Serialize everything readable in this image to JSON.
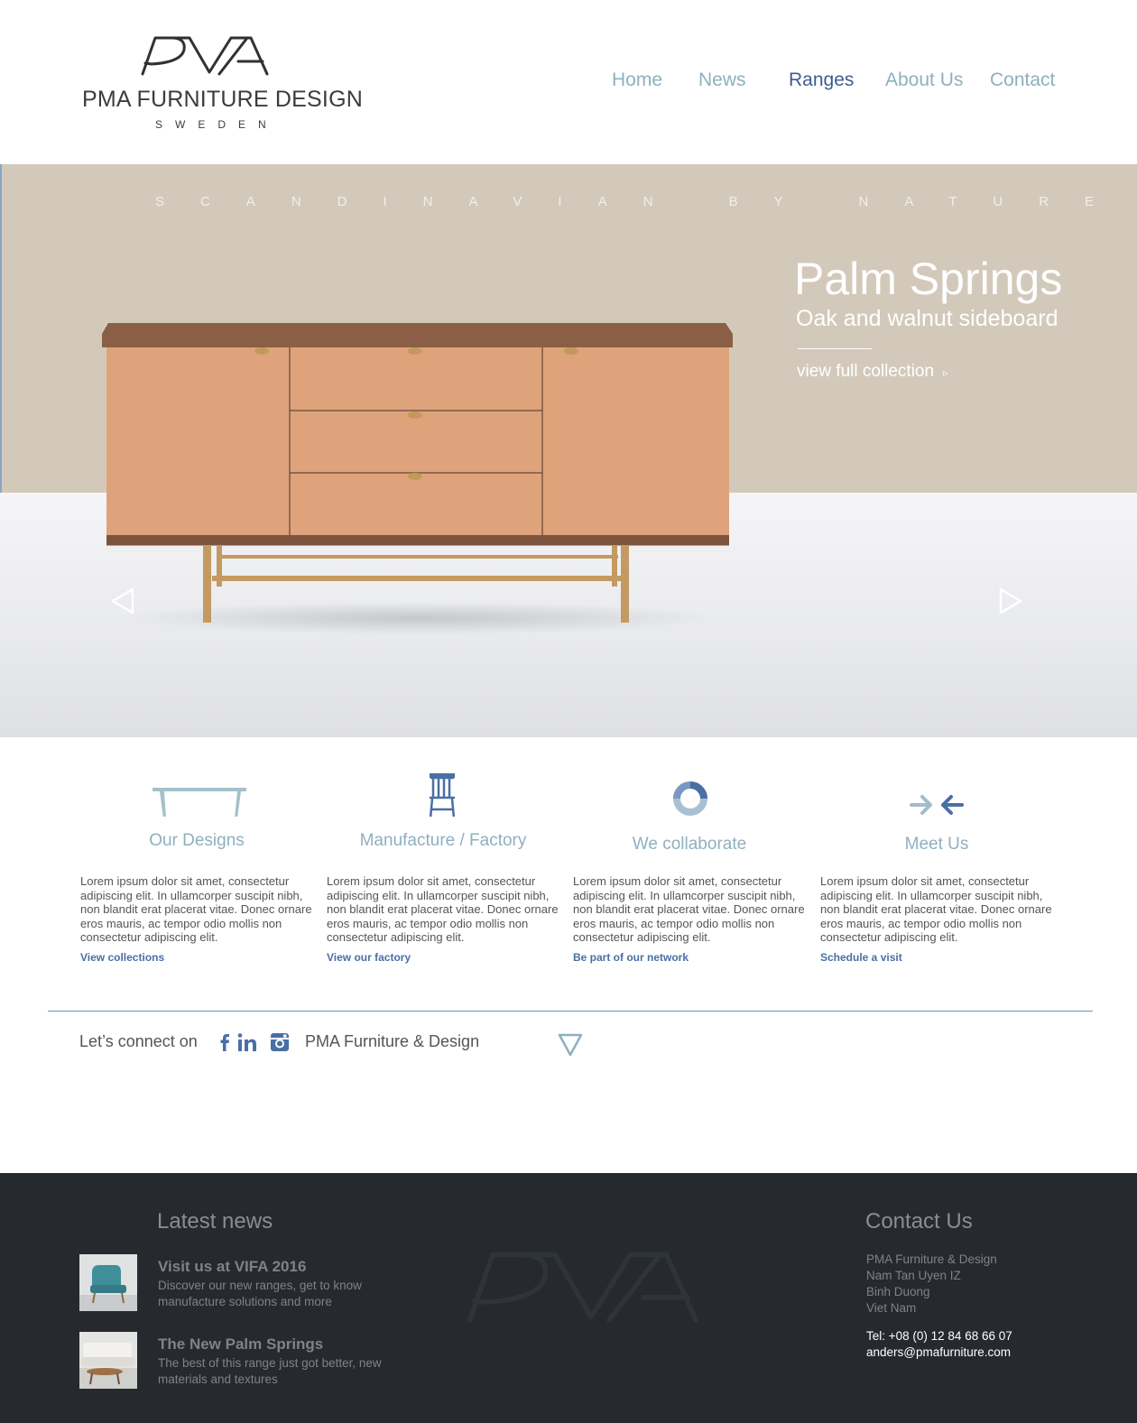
{
  "header": {
    "brand": "PMA FURNITURE DESIGN",
    "brand_sub": "SWEDEN",
    "nav": [
      "Home",
      "News",
      "Ranges",
      "About Us",
      "Contact"
    ],
    "active_nav": "Ranges"
  },
  "hero": {
    "tagline": "SCANDINAVIAN BY NATURE",
    "title": "Palm Springs",
    "subtitle": "Oak and walnut sideboard",
    "link": "view full collection",
    "link_arrow": "▹"
  },
  "features": [
    {
      "icon": "table-icon",
      "heading": "Our Designs",
      "body": "Lorem ipsum dolor sit amet, consectetur adipiscing elit. In ullamcorper suscipit nibh, non blandit erat placerat vitae. Donec ornare eros mauris, ac tempor odio mollis non consectetur adipiscing elit.",
      "link": "View collections"
    },
    {
      "icon": "chair-icon",
      "heading": "Manufacture / Factory",
      "body": "Lorem ipsum dolor sit amet, consectetur adipiscing elit. In ullamcorper suscipit nibh, non blandit erat placerat vitae. Donec ornare eros mauris, ac tempor odio mollis non consectetur adipiscing elit.",
      "link": "View our factory"
    },
    {
      "icon": "ring-icon",
      "heading": "We collaborate",
      "body": "Lorem ipsum dolor sit amet, consectetur adipiscing elit. In ullamcorper suscipit nibh, non blandit erat placerat vitae. Donec ornare eros mauris, ac tempor odio mollis non consectetur adipiscing elit.",
      "link": "Be part of our network"
    },
    {
      "icon": "converging-arrows-icon",
      "heading": "Meet Us",
      "body": "Lorem ipsum dolor sit amet, consectetur adipiscing elit. In ullamcorper suscipit nibh, non blandit erat placerat vitae. Donec ornare eros mauris, ac tempor odio mollis non consectetur adipiscing elit.",
      "link": "Schedule a visit"
    }
  ],
  "social": {
    "label": "Let’s connect on",
    "name": "PMA Furniture & Design",
    "icons": [
      "facebook-icon",
      "linkedin-icon",
      "instagram-icon"
    ]
  },
  "footer": {
    "news_title": "Latest news",
    "news": [
      {
        "title": "Visit us at VIFA 2016",
        "desc": "Discover our new ranges, get to know manufacture solutions and more"
      },
      {
        "title": "The New Palm Springs",
        "desc": "The best of this range just got better, new materials and textures"
      }
    ],
    "contact_title": "Contact Us",
    "address": [
      "PMA Furniture & Design",
      "Nam Tan Uyen IZ",
      "Binh Duong",
      "Viet Nam"
    ],
    "phone": "Tel: +08 (0) 12 84 68 66 07",
    "email": "anders@pmafurniture.com"
  },
  "colors": {
    "accent": "#3f5c91",
    "nav": "#8fb0bf",
    "link": "#4a6fa5",
    "hero_wall": "#d3c9bb",
    "footer_bg": "#262a2f"
  }
}
